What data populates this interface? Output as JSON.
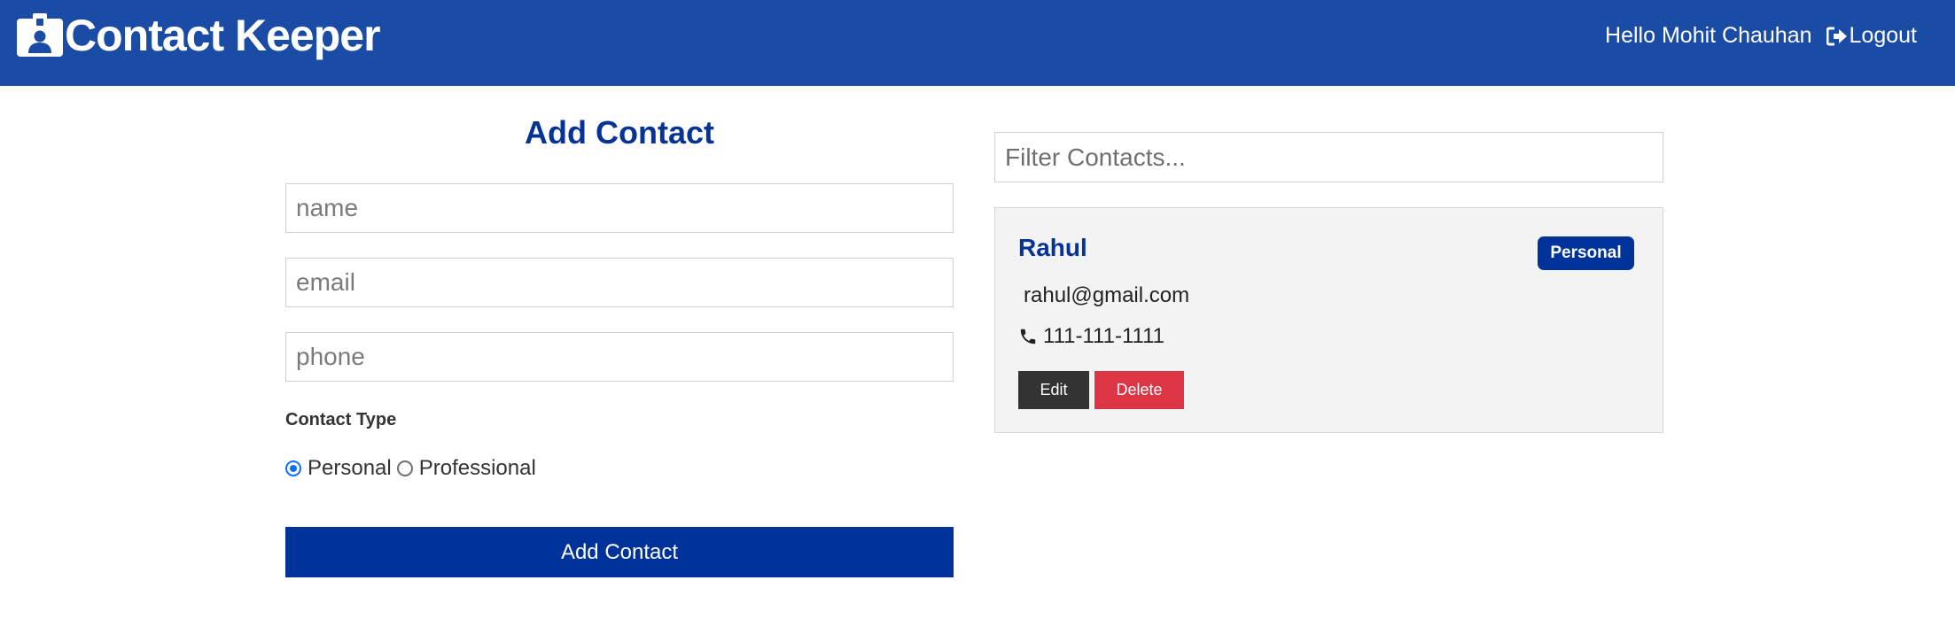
{
  "navbar": {
    "brand_icon": "id-badge-icon",
    "brand_title": "Contact Keeper",
    "greeting": "Hello Mohit Chauhan",
    "logout_icon": "sign-out-icon",
    "logout_label": "Logout",
    "background_color": "#1b4ca5"
  },
  "form": {
    "title": "Add Contact",
    "name_placeholder": "name",
    "email_placeholder": "email",
    "phone_placeholder": "phone",
    "contact_type_label": "Contact Type",
    "type_options": [
      {
        "label": "Personal",
        "checked": true
      },
      {
        "label": "Professional",
        "checked": false
      }
    ],
    "submit_label": "Add Contact",
    "accent_color": "#003399"
  },
  "filter": {
    "placeholder": "Filter Contacts..."
  },
  "contacts": [
    {
      "name": "Rahul",
      "type_badge": "Personal",
      "email": "rahul@gmail.com",
      "phone_icon": "phone-icon",
      "phone": "111-111-1111",
      "edit_label": "Edit",
      "delete_label": "Delete"
    }
  ],
  "colors": {
    "primary": "#003399",
    "dark": "#333333",
    "danger": "#dc3545",
    "card_background": "#f3f3f3"
  }
}
